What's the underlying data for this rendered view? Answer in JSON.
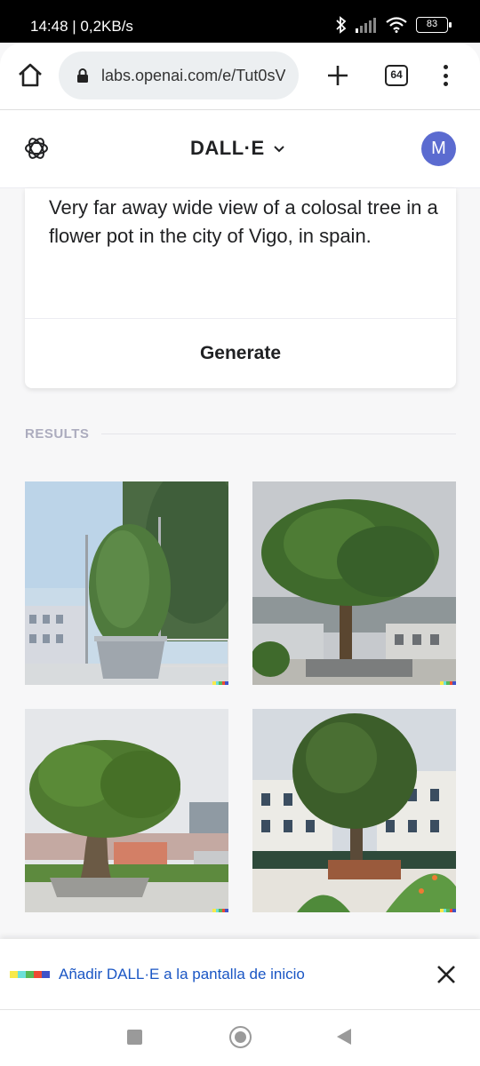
{
  "status_bar": {
    "time_speed": "14:48 | 0,2KB/s",
    "battery": "83"
  },
  "browser": {
    "url": "labs.openai.com/e/Tut0sV",
    "tab_count": "64"
  },
  "header": {
    "title": "DALL·E",
    "avatar_initial": "M"
  },
  "prompt": {
    "text": "Very far away wide view of a colosal tree in a flower pot in the city of Vigo, in spain.",
    "generate_label": "Generate"
  },
  "results": {
    "label": "RESULTS",
    "images": [
      {
        "icon": "image-potted-cypress"
      },
      {
        "icon": "image-large-oak"
      },
      {
        "icon": "image-bonsai-tree"
      },
      {
        "icon": "image-tree-planter"
      }
    ]
  },
  "install_banner": {
    "text": "Añadir DALL·E a la pantalla de inicio"
  },
  "colors": {
    "signature": [
      "#f7e94b",
      "#6be0d9",
      "#56b957",
      "#ee4a33",
      "#3f52c8"
    ],
    "avatar": "#5b6bd0",
    "banner_link": "#1a56c4"
  }
}
